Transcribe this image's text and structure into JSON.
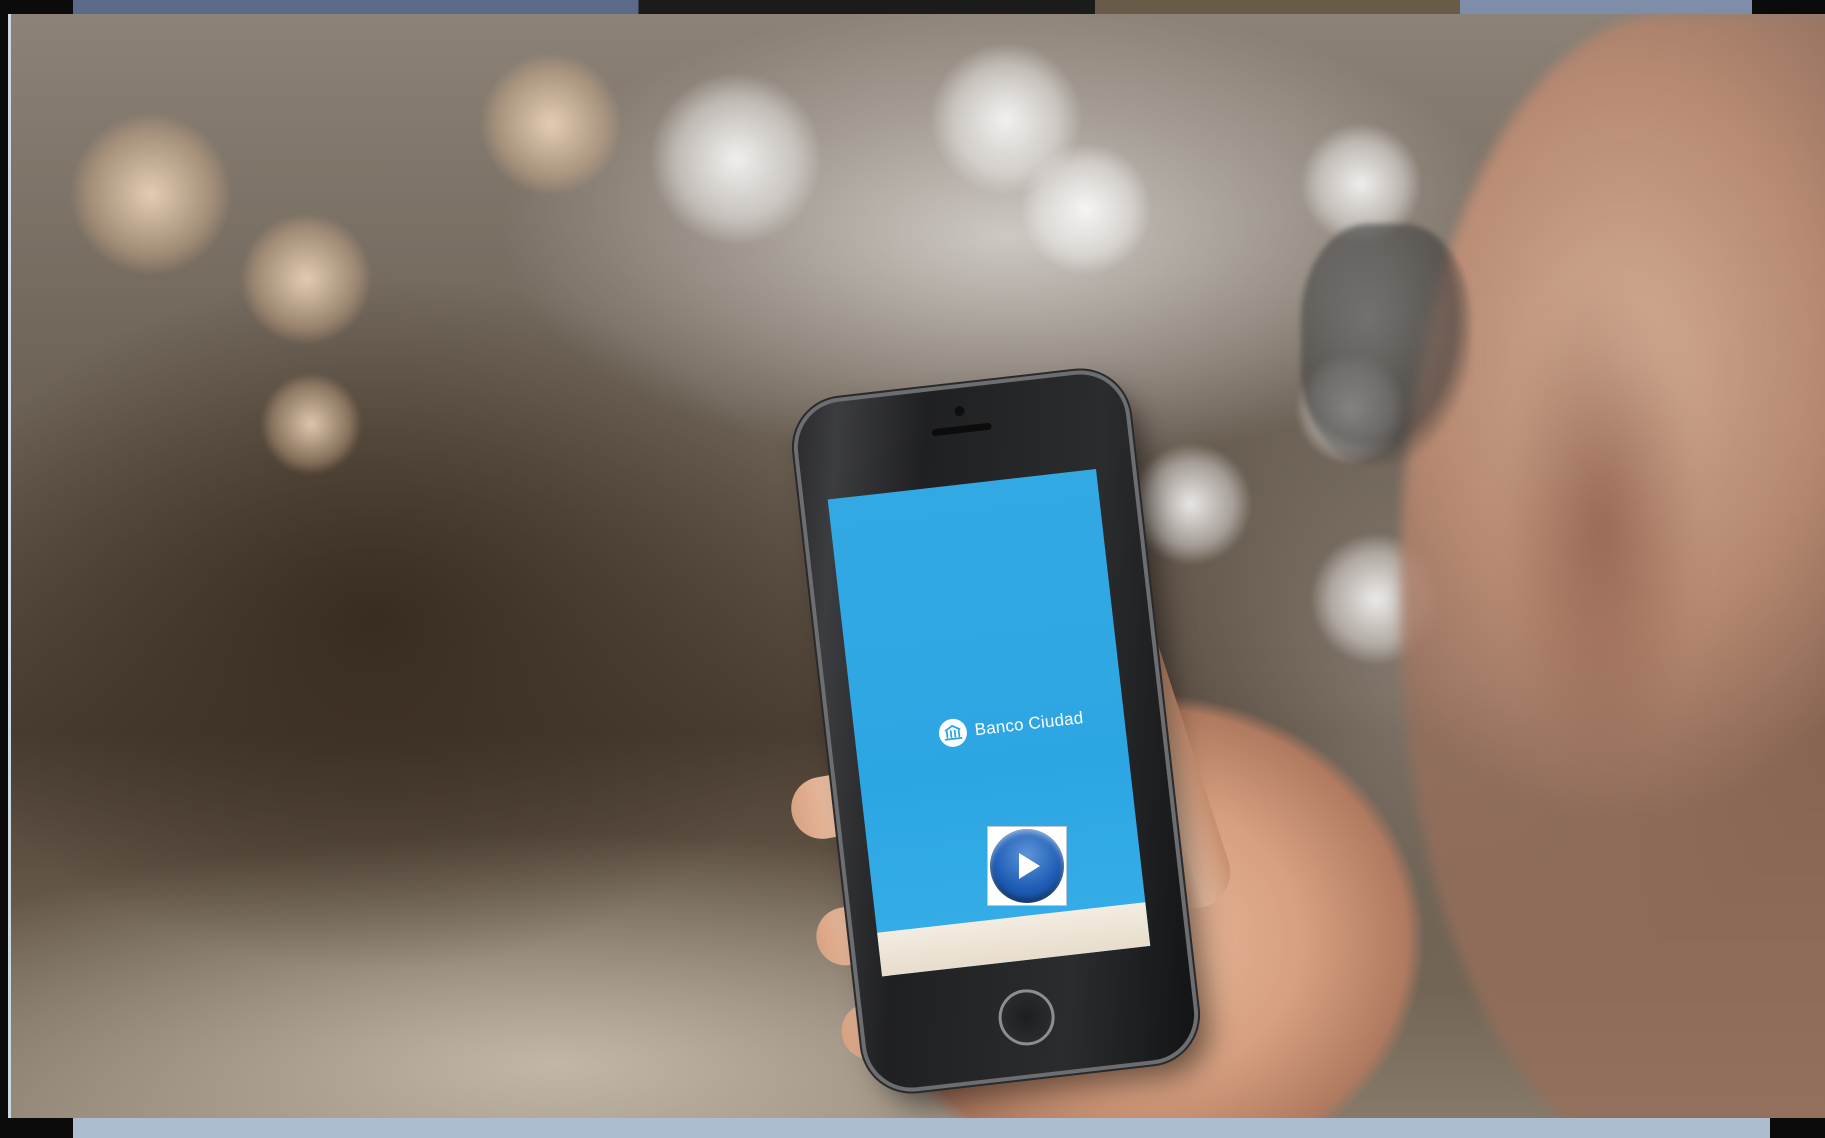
{
  "video": {
    "screen_brand": {
      "name": "Banco Ciudad",
      "logo_icon": "banco-ciudad-logo-icon"
    },
    "play_button": {
      "icon": "play-icon"
    }
  },
  "colors": {
    "screen_blue": "#2ca6e3",
    "play_blue": "#1f5eb6"
  }
}
